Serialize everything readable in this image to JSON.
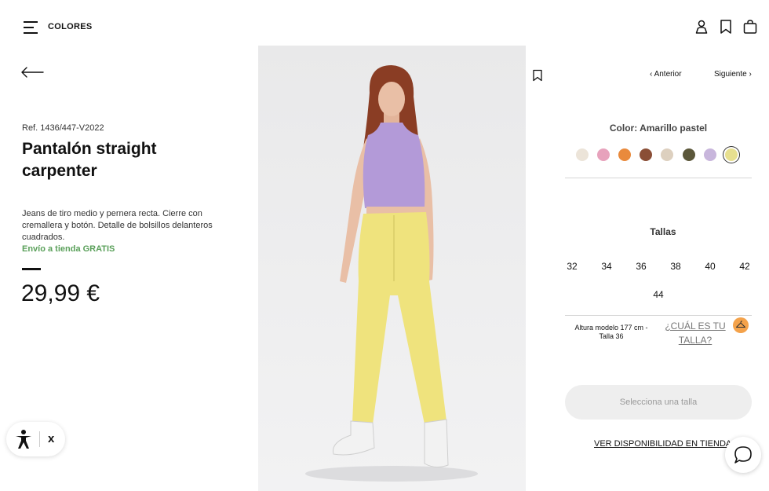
{
  "header": {
    "brand": "COLORES"
  },
  "product": {
    "ref": "Ref. 1436/447-V2022",
    "title": "Pantalón straight carpenter",
    "description": "Jeans de tiro medio y pernera recta. Cierre con cremallera y botón. Detalle de bolsillos delanteros cuadrados.",
    "shipping": "Envío a tienda GRATIS",
    "price": "29,99 €"
  },
  "nav": {
    "prev": "Anterior",
    "next": "Siguiente"
  },
  "colors": {
    "label": "Color: Amarillo pastel",
    "swatches": [
      "#ece4d9",
      "#e7a2bc",
      "#e98a3c",
      "#8a4e36",
      "#ddd0bf",
      "#5b573a",
      "#c8b6dc",
      "#e7df8f"
    ],
    "selected_index": 7
  },
  "sizes": {
    "label": "Tallas",
    "options": [
      "32",
      "34",
      "36",
      "38",
      "40",
      "42",
      "44"
    ]
  },
  "fit": {
    "model_info": "Altura modelo 177 cm - Talla 36",
    "link": "¿CUÁL ES TU TALLA?"
  },
  "actions": {
    "select_size": "Selecciona una talla",
    "availability": "VER DISPONIBILIDAD EN TIENDA"
  },
  "accessibility": {
    "close": "x"
  },
  "palette": {
    "top": "#b39ad8",
    "pants": "#efe37d",
    "skin": "#e9bfa6",
    "hair": "#8a3d24",
    "shipping_green": "#5aa05a",
    "hanger_orange": "#f4a24a"
  }
}
